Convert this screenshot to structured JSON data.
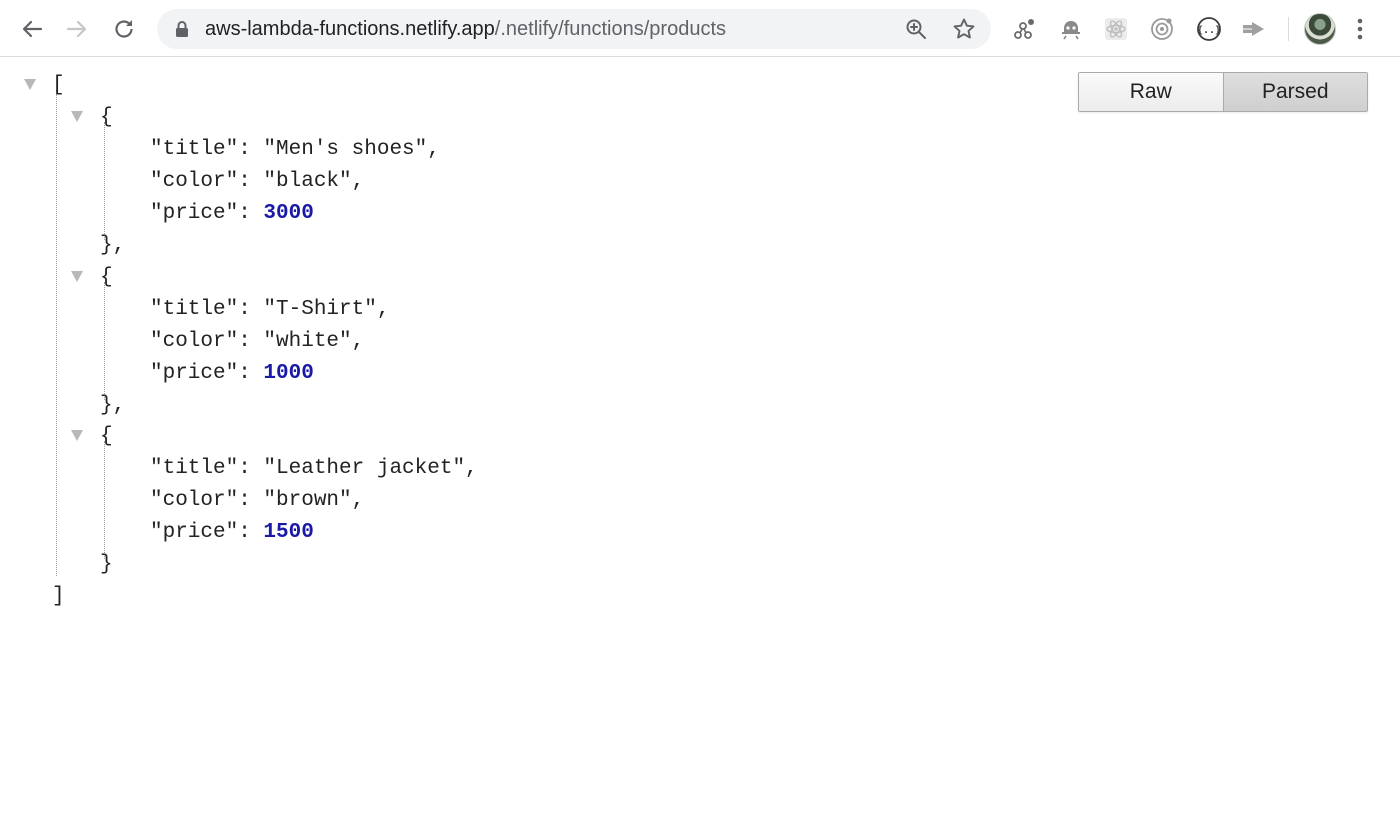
{
  "browser": {
    "url_host": "aws-lambda-functions.netlify.app",
    "url_path": "/.netlify/functions/products",
    "toolbar_icons": [
      "back-arrow-icon",
      "forward-arrow-icon",
      "reload-icon",
      "lock-icon",
      "zoom-icon",
      "star-icon",
      "extension-icon",
      "extension-icon",
      "react-devtools-icon",
      "extension-icon",
      "json-viewer-icon",
      "extension-icon",
      "avatar",
      "menu-icon"
    ]
  },
  "viewer": {
    "raw_label": "Raw",
    "parsed_label": "Parsed",
    "active_mode": "Parsed"
  },
  "json_lines": [
    "[",
    "{",
    "\"title\": ",
    "\"Men's shoes\",",
    "\"color\": \"black\",",
    "\"price\": ",
    "3000",
    "},",
    "{",
    "\"title\": \"T-Shirt\",",
    "\"color\": \"white\",",
    "\"price\": ",
    "1000",
    "},",
    "{",
    "\"title\": \"Leather jacket\",",
    "\"color\": \"brown\",",
    "\"price\": ",
    "1500",
    "}",
    "]"
  ],
  "colors": {
    "number": "#1a1aa6",
    "text": "#222222",
    "caret": "#b8b8b8"
  }
}
